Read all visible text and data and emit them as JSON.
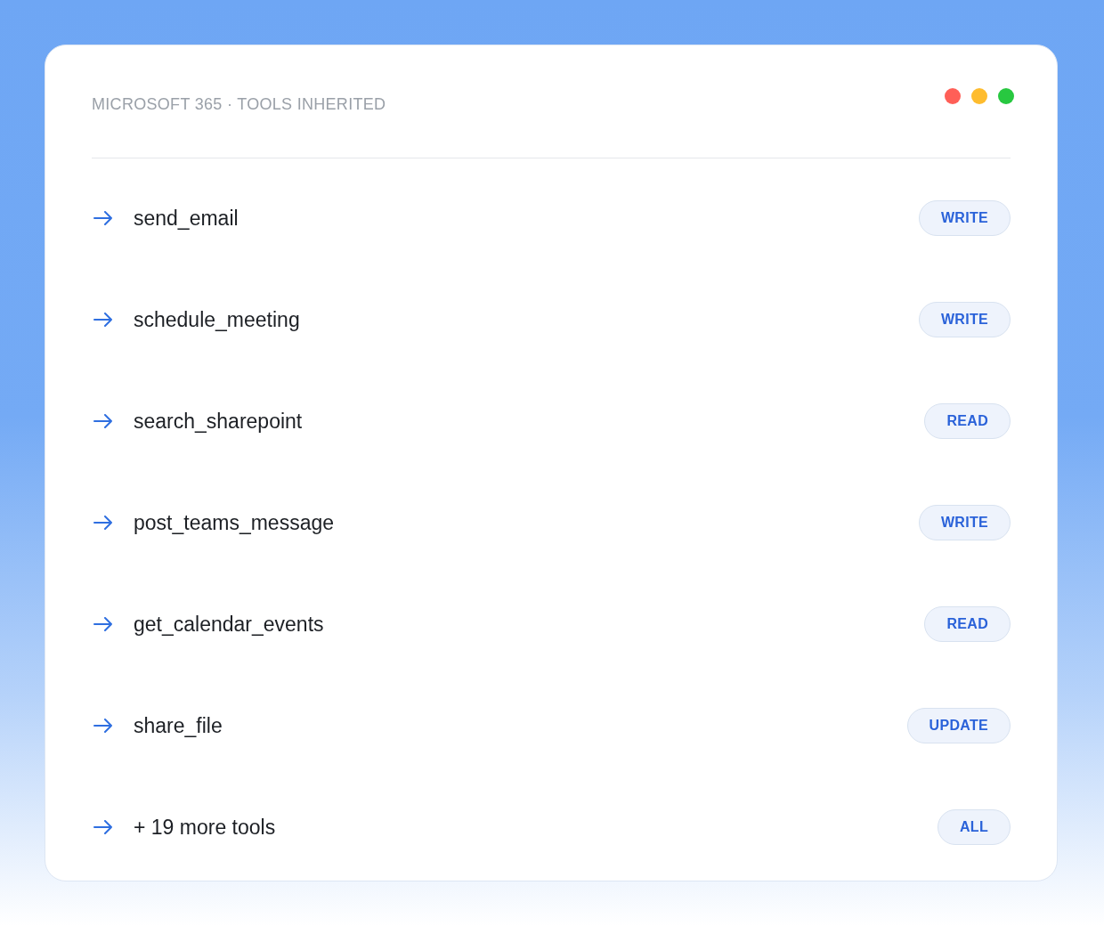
{
  "window": {
    "title": "MICROSOFT 365 · TOOLS INHERITED",
    "controls": [
      {
        "color": "#ff5f57"
      },
      {
        "color": "#febc2e"
      },
      {
        "color": "#28c840"
      }
    ]
  },
  "tools": [
    {
      "name": "send_email",
      "access": "WRITE"
    },
    {
      "name": "schedule_meeting",
      "access": "WRITE"
    },
    {
      "name": "search_sharepoint",
      "access": "READ"
    },
    {
      "name": "post_teams_message",
      "access": "WRITE"
    },
    {
      "name": "get_calendar_events",
      "access": "READ"
    },
    {
      "name": "share_file",
      "access": "UPDATE"
    },
    {
      "name": "+ 19 more tools",
      "access": "ALL"
    }
  ]
}
